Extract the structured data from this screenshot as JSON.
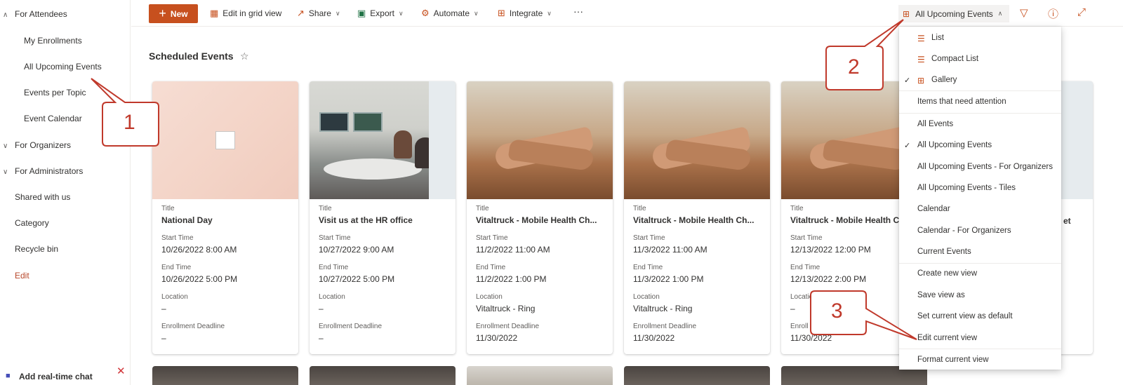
{
  "nav": {
    "groups": [
      {
        "label": "For Attendees"
      },
      {
        "label": "For Organizers"
      },
      {
        "label": "For Administrators"
      }
    ],
    "attendee_items": [
      "My Enrollments",
      "All Upcoming Events",
      "Events per Topic",
      "Event Calendar"
    ],
    "top_items": [
      "Shared with us",
      "Category",
      "Recycle bin"
    ],
    "edit_label": "Edit",
    "chat_label": "Add real-time chat",
    "chat_icon": "teams-icon",
    "close_icon": "close-icon"
  },
  "toolbar": {
    "new_label": "New",
    "edit_grid_label": "Edit in grid view",
    "share_label": "Share",
    "export_label": "Export",
    "automate_label": "Automate",
    "integrate_label": "Integrate",
    "more_label": "···",
    "view_selector_label": "All Upcoming Events"
  },
  "page": {
    "title": "Scheduled Events"
  },
  "cards": [
    {
      "title_label": "Title",
      "title": "National Day",
      "start_label": "Start Time",
      "start": "10/26/2022 8:00 AM",
      "end_label": "End Time",
      "end": "10/26/2022 5:00 PM",
      "location_label": "Location",
      "location": "–",
      "deadline_label": "Enrollment Deadline",
      "deadline": "–"
    },
    {
      "title_label": "Title",
      "title": "Visit us at the HR office",
      "start_label": "Start Time",
      "start": "10/27/2022 9:00 AM",
      "end_label": "End Time",
      "end": "10/27/2022 5:00 PM",
      "location_label": "Location",
      "location": "–",
      "deadline_label": "Enrollment Deadline",
      "deadline": "–"
    },
    {
      "title_label": "Title",
      "title": "Vitaltruck - Mobile Health Ch...",
      "start_label": "Start Time",
      "start": "11/2/2022 11:00 AM",
      "end_label": "End Time",
      "end": "11/2/2022 1:00 PM",
      "location_label": "Location",
      "location": "Vitaltruck - Ring",
      "deadline_label": "Enrollment Deadline",
      "deadline": "11/30/2022"
    },
    {
      "title_label": "Title",
      "title": "Vitaltruck - Mobile Health Ch...",
      "start_label": "Start Time",
      "start": "11/3/2022 11:00 AM",
      "end_label": "End Time",
      "end": "11/3/2022 1:00 PM",
      "location_label": "Location",
      "location": "Vitaltruck - Ring",
      "deadline_label": "Enrollment Deadline",
      "deadline": "11/30/2022"
    },
    {
      "title_label": "Title",
      "title": "Vitaltruck - Mobile Health C",
      "start_label": "Start Time",
      "start": "12/13/2022 12:00 PM",
      "end_label": "End Time",
      "end": "12/13/2022 2:00 PM",
      "location_label": "Location",
      "location": "–",
      "deadline_label": "Enroll",
      "deadline": "11/30/2022"
    }
  ],
  "partial_card_title_tail": "et",
  "menu": {
    "items": [
      {
        "label": "List",
        "icon": "list-icon",
        "checked": false
      },
      {
        "label": "Compact List",
        "icon": "compact-list-icon",
        "checked": false
      },
      {
        "label": "Gallery",
        "icon": "gallery-icon",
        "checked": true
      },
      {
        "label": "Items that need attention",
        "checked": false
      },
      {
        "label": "All Events",
        "checked": false
      },
      {
        "label": "All Upcoming Events",
        "checked": true
      },
      {
        "label": "All Upcoming Events - For Organizers",
        "checked": false
      },
      {
        "label": "All Upcoming Events - Tiles",
        "checked": false
      },
      {
        "label": "Calendar",
        "checked": false
      },
      {
        "label": "Calendar - For Organizers",
        "checked": false
      },
      {
        "label": "Current Events",
        "checked": false
      },
      {
        "label": "Create new view",
        "checked": false
      },
      {
        "label": "Save view as",
        "checked": false
      },
      {
        "label": "Set current view as default",
        "checked": false
      },
      {
        "label": "Edit current view",
        "checked": false
      },
      {
        "label": "Format current view",
        "checked": false
      }
    ]
  },
  "callouts": [
    "1",
    "2",
    "3"
  ],
  "colors": {
    "accent": "#c7501e",
    "callout": "#c0392b"
  }
}
